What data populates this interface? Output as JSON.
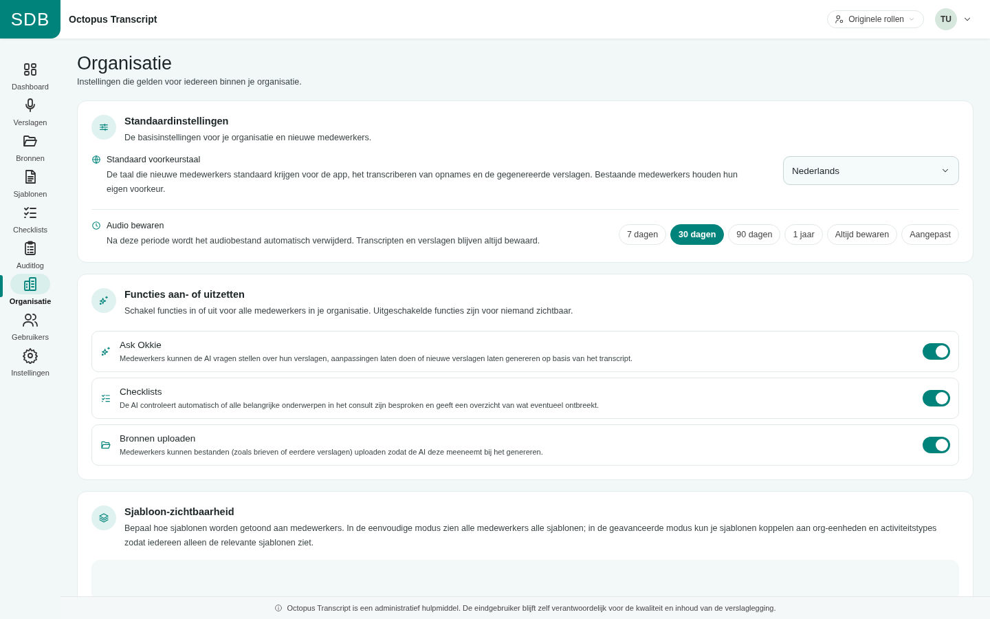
{
  "header": {
    "logo": "SDB",
    "app_title": "Octopus Transcript",
    "roles_button": "Originele rollen",
    "avatar": "TU"
  },
  "sidebar": {
    "items": [
      {
        "label": "Dashboard",
        "selected": false
      },
      {
        "label": "Verslagen",
        "selected": false
      },
      {
        "label": "Bronnen",
        "selected": false
      },
      {
        "label": "Sjablonen",
        "selected": false
      },
      {
        "label": "Checklists",
        "selected": false
      },
      {
        "label": "Auditlog",
        "selected": false
      },
      {
        "label": "Organisatie",
        "selected": true
      },
      {
        "label": "Gebruikers",
        "selected": false
      },
      {
        "label": "Instellingen",
        "selected": false
      }
    ]
  },
  "page": {
    "title": "Organisatie",
    "subtitle": "Instellingen die gelden voor iedereen binnen je organisatie."
  },
  "defaults": {
    "title": "Standaardinstellingen",
    "description": "De basisinstellingen voor je organisatie en nieuwe medewerkers.",
    "language": {
      "label": "Standaard voorkeurstaal",
      "description": "De taal die nieuwe medewerkers standaard krijgen voor de app, het transcriberen van opnames en de gegenereerde verslagen. Bestaande medewerkers houden hun eigen voorkeur.",
      "value": "Nederlands"
    },
    "audio": {
      "label": "Audio bewaren",
      "description": "Na deze periode wordt het audiobestand automatisch verwijderd. Transcripten en verslagen blijven altijd bewaard.",
      "options": [
        {
          "label": "7 dagen",
          "selected": false
        },
        {
          "label": "30 dagen",
          "selected": true
        },
        {
          "label": "90 dagen",
          "selected": false
        },
        {
          "label": "1 jaar",
          "selected": false
        },
        {
          "label": "Altijd bewaren",
          "selected": false
        },
        {
          "label": "Aangepast",
          "selected": false
        }
      ]
    }
  },
  "features": {
    "title": "Functies aan- of uitzetten",
    "description": "Schakel functies in of uit voor alle medewerkers in je organisatie. Uitgeschakelde functies zijn voor niemand zichtbaar.",
    "items": [
      {
        "name": "Ask Okkie",
        "description": "Medewerkers kunnen de AI vragen stellen over hun verslagen, aanpassingen laten doen of nieuwe verslagen laten genereren op basis van het transcript.",
        "on": true
      },
      {
        "name": "Checklists",
        "description": "De AI controleert automatisch of alle belangrijke onderwerpen in het consult zijn besproken en geeft een overzicht van wat eventueel ontbreekt.",
        "on": true
      },
      {
        "name": "Bronnen uploaden",
        "description": "Medewerkers kunnen bestanden (zoals brieven of eerdere verslagen) uploaden zodat de AI deze meeneemt bij het genereren.",
        "on": true
      }
    ]
  },
  "templates": {
    "title": "Sjabloon-zichtbaarheid",
    "description": "Bepaal hoe sjablonen worden getoond aan medewerkers. In de eenvoudige modus zien alle medewerkers alle sjablonen; in de geavanceerde modus kun je sjablonen koppelen aan org-eenheden en activiteitstypes zodat iedereen alleen de relevante sjablonen ziet."
  },
  "footer": "Octopus Transcript is een administratief hulpmiddel. De eindgebruiker blijft zelf verantwoordelijk voor de kwaliteit en inhoud van de verslaglegging."
}
